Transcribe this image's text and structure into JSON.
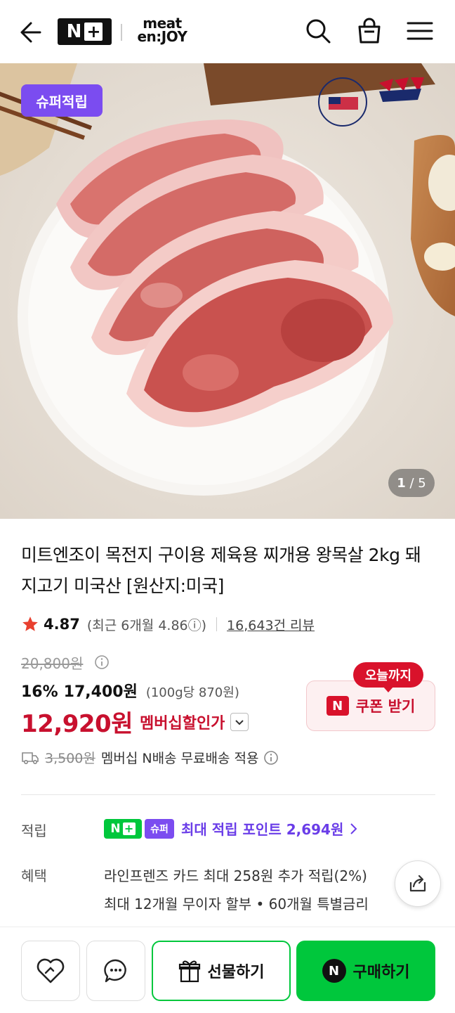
{
  "header": {
    "logo_np": "N",
    "logo_plus": "+",
    "brand_line1": "meat",
    "brand_line2": "en:JOY"
  },
  "hero": {
    "badge": "슈퍼적립",
    "counter_current": "1",
    "counter_total": "/ 5",
    "logo_meat": "U.S.MEAT",
    "logo_pork": "U.S. PORK"
  },
  "product": {
    "title": "미트엔조이 목전지 구이용 제육용 찌개용 왕목살 2kg 돼지고기 미국산 [원산지:미국]",
    "rating": "4.87",
    "recent_rating": "(최근 6개월 4.86ⓘ)",
    "review_count": "16,643건 리뷰",
    "original_price": "20,800원",
    "discount_pct": "16%",
    "sale_price": "17,400원",
    "unit_price": "(100g당 870원)",
    "member_price": "12,920원",
    "member_label": "멤버십할인가",
    "coupon_tag": "오늘까지",
    "coupon_n": "N",
    "coupon_label": "쿠폰 받기",
    "ship_fee": "3,500원",
    "ship_text": "멤버십 N배송 무료배송 적용"
  },
  "benefits": {
    "points_label": "적립",
    "np_text": "N",
    "np_plus": "+",
    "super_text": "슈퍼",
    "points_text": "최대 적립 포인트 2,694원",
    "benefit_label": "혜택",
    "benefit_line1": "라인프렌즈 카드 최대 258원 추가 적립(2%)",
    "benefit_line2": "최대 12개월 무이자 할부 • 60개월 특별금리"
  },
  "bottom_bar": {
    "gift_label": "선물하기",
    "buy_n": "N",
    "buy_label": "구매하기"
  },
  "colors": {
    "accent_green": "#00c73c",
    "accent_red": "#c8102e",
    "accent_purple": "#7b4cf0"
  }
}
